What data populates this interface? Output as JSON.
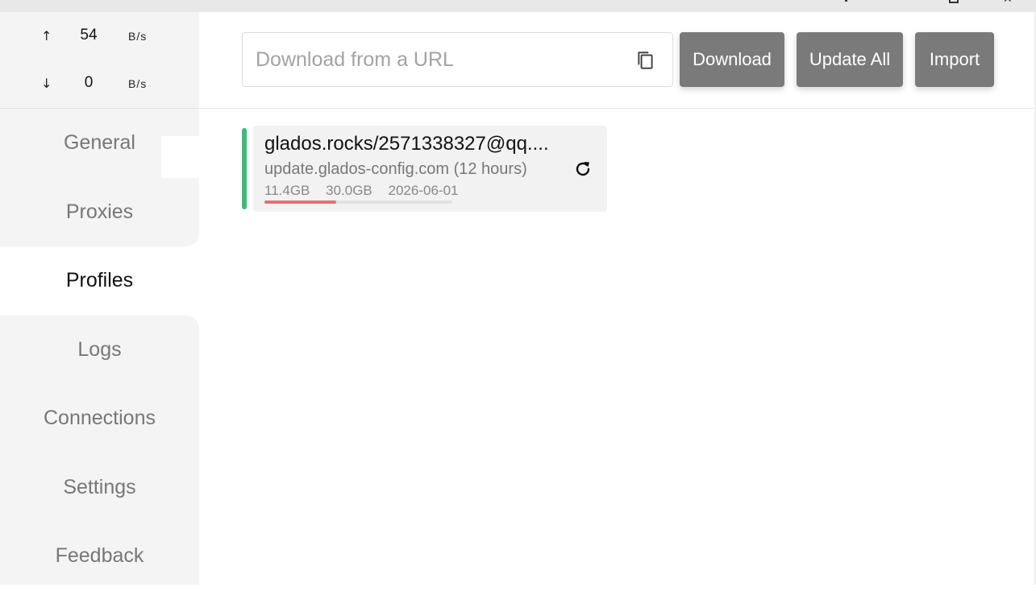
{
  "traffic": {
    "upload": {
      "arrow": "↑",
      "value": "54",
      "unit": "B/s"
    },
    "download": {
      "arrow": "↓",
      "value": "0",
      "unit": "B/s"
    }
  },
  "sidebar": {
    "items": [
      {
        "label": "General"
      },
      {
        "label": "Proxies"
      },
      {
        "label": "Profiles",
        "active": true
      },
      {
        "label": "Logs"
      },
      {
        "label": "Connections"
      },
      {
        "label": "Settings"
      },
      {
        "label": "Feedback"
      }
    ]
  },
  "toolbar": {
    "url_placeholder": "Download from a URL",
    "copy_icon": "copy-icon",
    "download_label": "Download",
    "update_all_label": "Update All",
    "import_label": "Import"
  },
  "profiles": [
    {
      "name": "glados.rocks/2571338327@qq....",
      "source": "update.glados-config.com (12 hours)",
      "used": "11.4GB",
      "total": "30.0GB",
      "expires": "2026-06-01",
      "usage_fraction": 0.38,
      "selected": true
    }
  ],
  "colors": {
    "accent_selected": "#44b87c",
    "usage_bar": "#ef6b78",
    "button_bg": "#7a7a7a"
  }
}
